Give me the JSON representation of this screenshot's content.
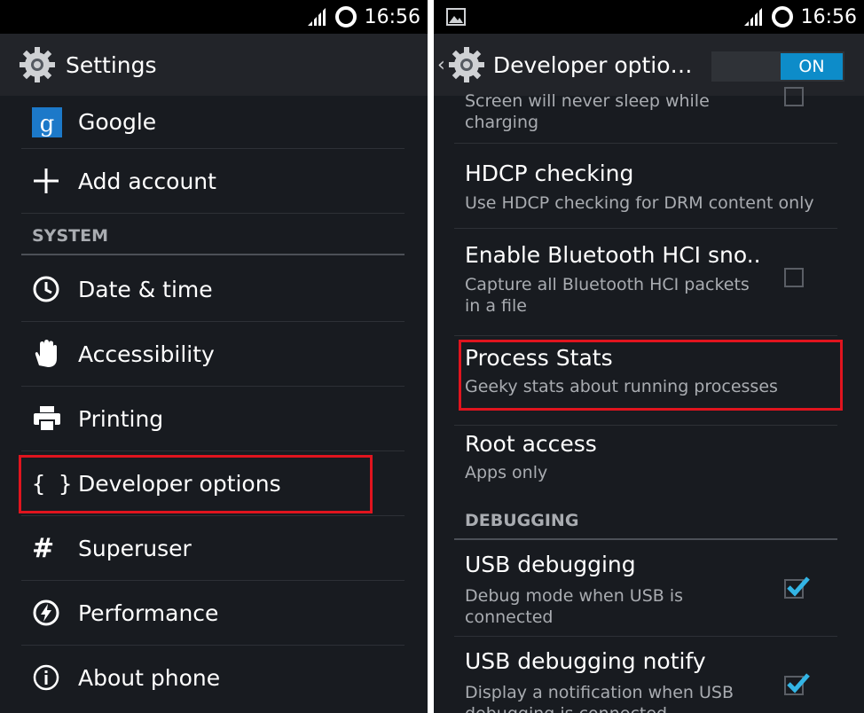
{
  "left": {
    "status": {
      "time": "16:56"
    },
    "actionbar": {
      "title": "Settings"
    },
    "items_top": [
      {
        "label": "Google"
      },
      {
        "label": "Add account"
      }
    ],
    "section_system": "SYSTEM",
    "items_system": [
      {
        "label": "Date & time"
      },
      {
        "label": "Accessibility"
      },
      {
        "label": "Printing"
      },
      {
        "label": "Developer options"
      },
      {
        "label": "Superuser"
      },
      {
        "label": "Performance"
      },
      {
        "label": "About phone"
      }
    ]
  },
  "right": {
    "status": {
      "time": "16:56"
    },
    "actionbar": {
      "title": "Developer optio…",
      "toggle_label": "ON"
    },
    "partial_item": {
      "subtitle": "Screen will never sleep while charging",
      "checked": false
    },
    "items": [
      {
        "title": "HDCP checking",
        "subtitle": "Use HDCP checking for DRM content only"
      },
      {
        "title": "Enable Bluetooth HCI sno..",
        "subtitle": "Capture all Bluetooth HCI packets in a file",
        "checked": false
      },
      {
        "title": "Process Stats",
        "subtitle": "Geeky stats about running processes"
      },
      {
        "title": "Root access",
        "subtitle": "Apps only"
      }
    ],
    "section_debugging": "DEBUGGING",
    "debug_items": [
      {
        "title": "USB debugging",
        "subtitle": "Debug mode when USB is connected",
        "checked": true
      },
      {
        "title": "USB debugging notify",
        "subtitle": "Display a notification when USB debugging is connected",
        "checked": true
      }
    ]
  },
  "colors": {
    "background": "#181b20",
    "accent": "#0d8cc9",
    "highlight": "#e0141e",
    "checkmark": "#33b5e5"
  }
}
